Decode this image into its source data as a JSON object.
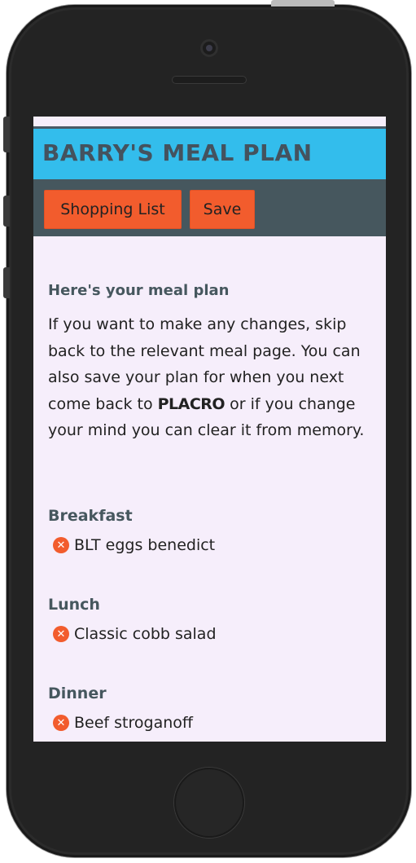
{
  "app": {
    "title": "BARRY'S MEAL PLAN",
    "accent_color": "#33bdec",
    "button_color": "#f25c2d",
    "toolbar_color": "#46575e"
  },
  "toolbar": {
    "shopping_list_label": "Shopping List",
    "save_label": "Save"
  },
  "intro": {
    "title": "Here's your meal plan",
    "text_before_brand": "If you want to make any changes, skip back to the relevant meal page. You can also save your plan for when you next come back to ",
    "brand": "PLACRO",
    "text_after_brand": " or if you change your mind you can clear it from memory."
  },
  "meals": [
    {
      "section": "Breakfast",
      "item": "BLT eggs benedict",
      "icon": "remove-icon"
    },
    {
      "section": "Lunch",
      "item": "Classic cobb salad",
      "icon": "remove-icon"
    },
    {
      "section": "Dinner",
      "item": "Beef stroganoff",
      "icon": "remove-icon"
    }
  ]
}
